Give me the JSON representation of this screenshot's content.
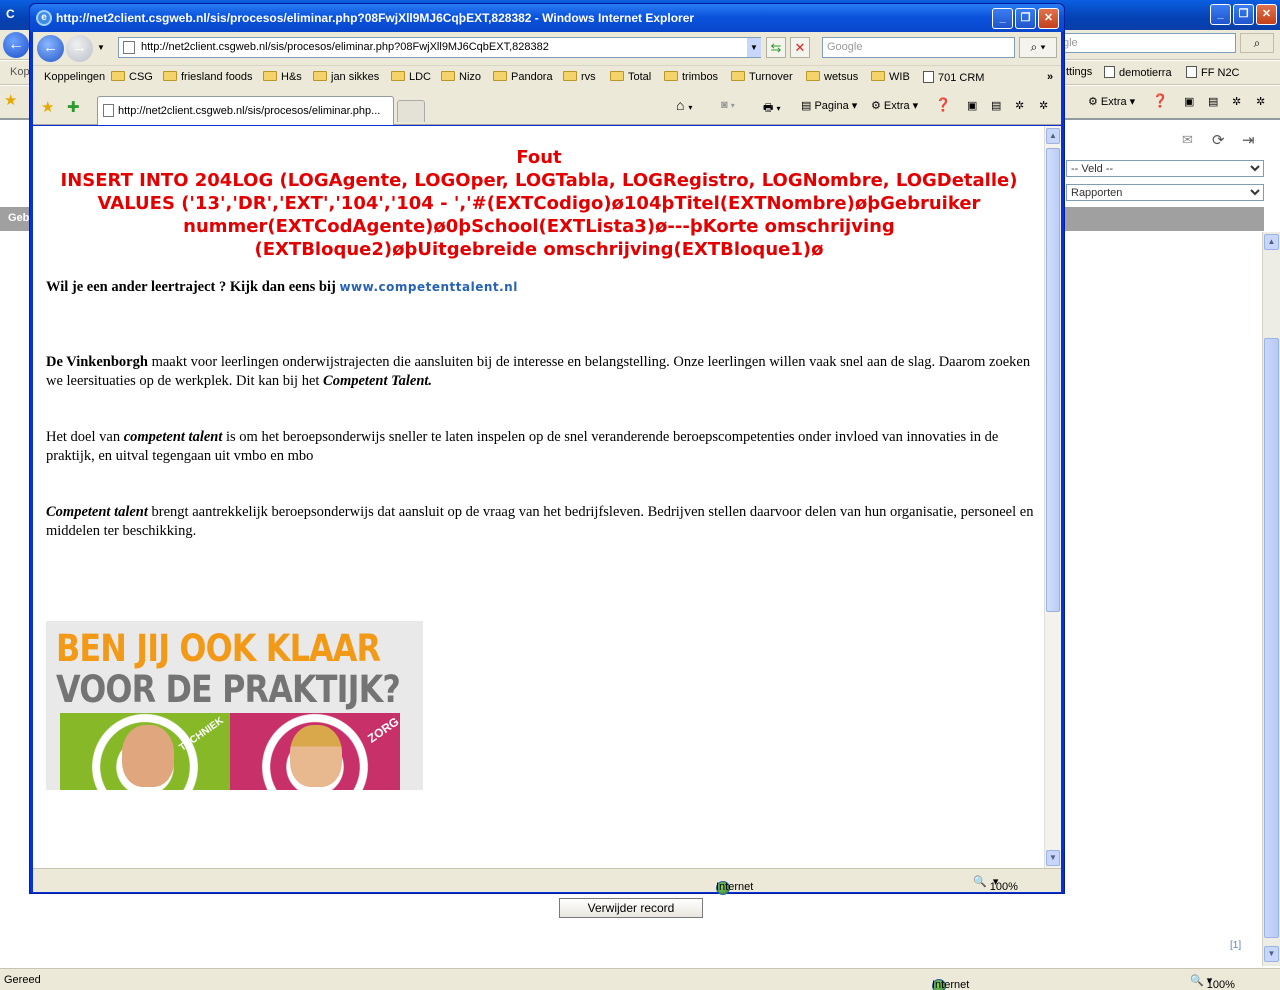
{
  "background_window": {
    "title_fragment": "C",
    "search_placeholder": "gle",
    "links_label": "Kop",
    "links": [
      "ttings",
      "demotierra",
      "FF N2C"
    ],
    "toolbar": [
      "Extra"
    ],
    "select_veld": "-- Veld --",
    "select_rapporten": "Rapporten",
    "strip_label": "Geb",
    "delete_button": "Verwijder record",
    "pager": "[1]",
    "status_left": "Gereed",
    "status_zone": "Internet",
    "status_zoom": "100%"
  },
  "popup": {
    "title": "http://net2client.csgweb.nl/sis/procesos/eliminar.php?08FwjXll9MJ6CqþEXT,828382 - Windows Internet Explorer",
    "url": "http://net2client.csgweb.nl/sis/procesos/eliminar.php?08FwjXll9MJ6CqbEXT,828382",
    "search_placeholder": "Google",
    "links_label": "Koppelingen",
    "links": [
      "CSG",
      "friesland foods",
      "H&s",
      "jan sikkes",
      "LDC",
      "Nizo",
      "Pandora",
      "rvs",
      "Total",
      "trimbos",
      "Turnover",
      "wetsus",
      "WIB",
      "701 CRM"
    ],
    "tab_label": "http://net2client.csgweb.nl/sis/procesos/eliminar.php...",
    "tools": [
      "Pagina",
      "Extra"
    ],
    "status_zone": "Internet",
    "status_zoom": "100%"
  },
  "page": {
    "error_title": "Fout",
    "error_body": "INSERT INTO 204LOG (LOGAgente, LOGOper, LOGTabla, LOGRegistro, LOGNombre, LOGDetalle) VALUES ('13','DR','EXT','104','104 - ','#(EXTCodigo)ø104þTitel(EXTNombre)øþGebruiker nummer(EXTCodAgente)ø0þSchool(EXTLista3)ø---þKorte omschrijving (EXTBloque2)øþUitgebreide omschrijving(EXTBloque1)ø",
    "p1_text": "Wil je een ander leertraject ? Kijk dan eens bij",
    "p1_link": "www.competenttalent.nl",
    "p2_bold": "De Vinkenborgh",
    "p2_text": " maakt voor leerlingen onderwijstrajecten die aansluiten bij de interesse en belangstelling. Onze leerlingen willen vaak snel aan de slag. Daarom zoeken we leersituaties op de werkplek. Dit kan bij het ",
    "p2_em": "Competent Talent.",
    "p3_a": "Het doel van ",
    "p3_em": "competent talent",
    "p3_b": " is om het beroepsonderwijs sneller te laten inspelen op de snel veranderende beroepscompetenties onder invloed van innovaties in de praktijk, en uitval tegengaan uit vmbo en mbo",
    "p4_em": "Competent talent",
    "p4_text": " brengt aantrekkelijk beroepsonderwijs dat aansluit op de vraag van het bedrijfsleven. Bedrijven stellen daarvoor delen van hun organisatie, personeel en middelen ter beschikking.",
    "banner_line1": "BEN JIJ OOK KLAAR",
    "banner_line2": "VOOR DE PRAKTIJK?",
    "banner_tag1": "TECHNIEK",
    "banner_tag2": "ZORG"
  }
}
